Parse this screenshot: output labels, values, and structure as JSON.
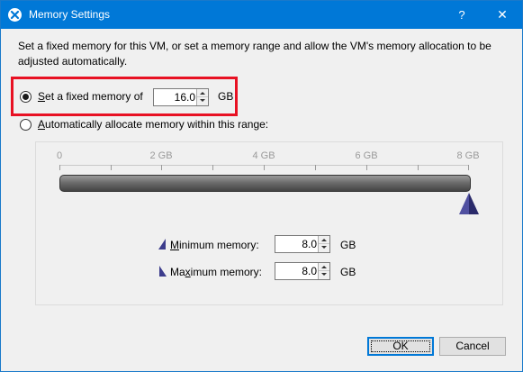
{
  "window": {
    "title": "Memory Settings",
    "help_label": "?",
    "close_label": "✕"
  },
  "intro_text": "Set a fixed memory for this VM, or set a memory range and allow the VM's memory allocation to be adjusted automatically.",
  "fixed": {
    "selected": true,
    "label_mnemonic": "S",
    "label_rest": "et a fixed memory of",
    "value": "16.0",
    "unit": "GB"
  },
  "auto": {
    "selected": false,
    "label_mnemonic": "A",
    "label_rest": "utomatically allocate memory within this range:"
  },
  "range": {
    "axis_labels": [
      "0",
      "2 GB",
      "4 GB",
      "6 GB",
      "8 GB"
    ],
    "axis_min": 0,
    "axis_max": 8,
    "minimum": {
      "label_mnemonic": "M",
      "label_rest": "inimum memory:",
      "value": "8.0",
      "unit": "GB"
    },
    "maximum": {
      "label_pre": "Ma",
      "label_mnemonic": "x",
      "label_rest": "imum memory:",
      "value": "8.0",
      "unit": "GB"
    }
  },
  "buttons": {
    "ok": "OK",
    "cancel": "Cancel"
  },
  "colors": {
    "titlebar": "#0078d7",
    "highlight_box": "#e81123",
    "marker": "#3c3c8c"
  }
}
